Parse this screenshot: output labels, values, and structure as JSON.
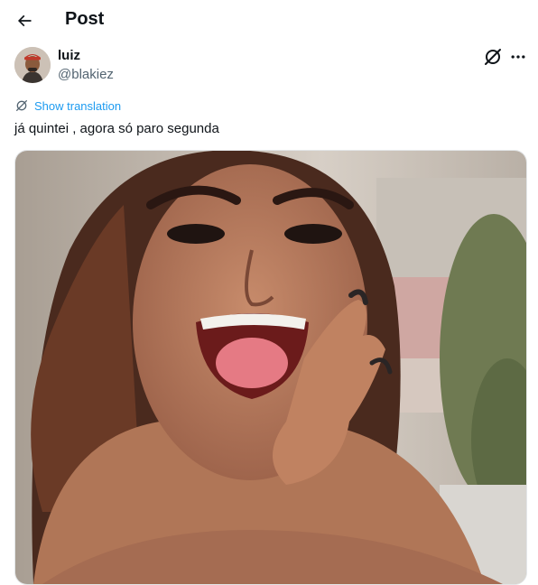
{
  "header": {
    "title": "Post",
    "back_icon": "arrow-left-icon"
  },
  "tweet": {
    "author_name": "luiz",
    "author_handle": "@blakiez",
    "translate_label": "Show translation",
    "text": "já quintei , agora só paro segunda",
    "actions": {
      "grok_icon": "grok-icon",
      "more_icon": "more-dots-icon"
    }
  },
  "colors": {
    "link": "#1d9bf0",
    "secondary_text": "#536471",
    "primary_text": "#0f1419"
  }
}
